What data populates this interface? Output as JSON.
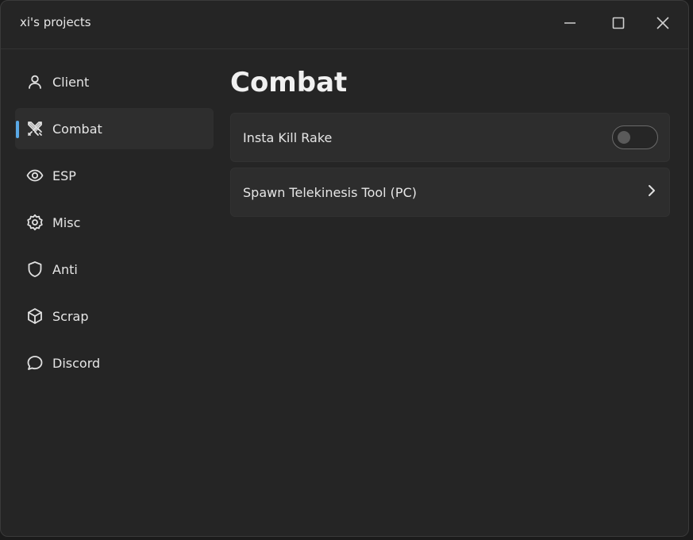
{
  "window": {
    "title": "xi's projects",
    "controls": [
      "minimize-icon",
      "maximize-icon",
      "close-icon"
    ]
  },
  "sidebar": {
    "items": [
      {
        "label": "Client",
        "icon": "user-icon",
        "active": false
      },
      {
        "label": "Combat",
        "icon": "swords-icon",
        "active": true
      },
      {
        "label": "ESP",
        "icon": "eye-icon",
        "active": false
      },
      {
        "label": "Misc",
        "icon": "gear-icon",
        "active": false
      },
      {
        "label": "Anti",
        "icon": "shield-icon",
        "active": false
      },
      {
        "label": "Scrap",
        "icon": "box-icon",
        "active": false
      },
      {
        "label": "Discord",
        "icon": "chat-bubble-icon",
        "active": false
      }
    ]
  },
  "main": {
    "title": "Combat",
    "options": [
      {
        "label": "Insta Kill Rake",
        "type": "toggle",
        "enabled": false
      },
      {
        "label": "Spawn Telekinesis Tool (PC)",
        "type": "button",
        "icon": "chevron-right-icon"
      }
    ]
  },
  "colors": {
    "window_bg": "#252525",
    "active_item_bg": "#2e2e2e",
    "accent": "#5aa9e6",
    "card_bg": "#2d2d2d"
  }
}
